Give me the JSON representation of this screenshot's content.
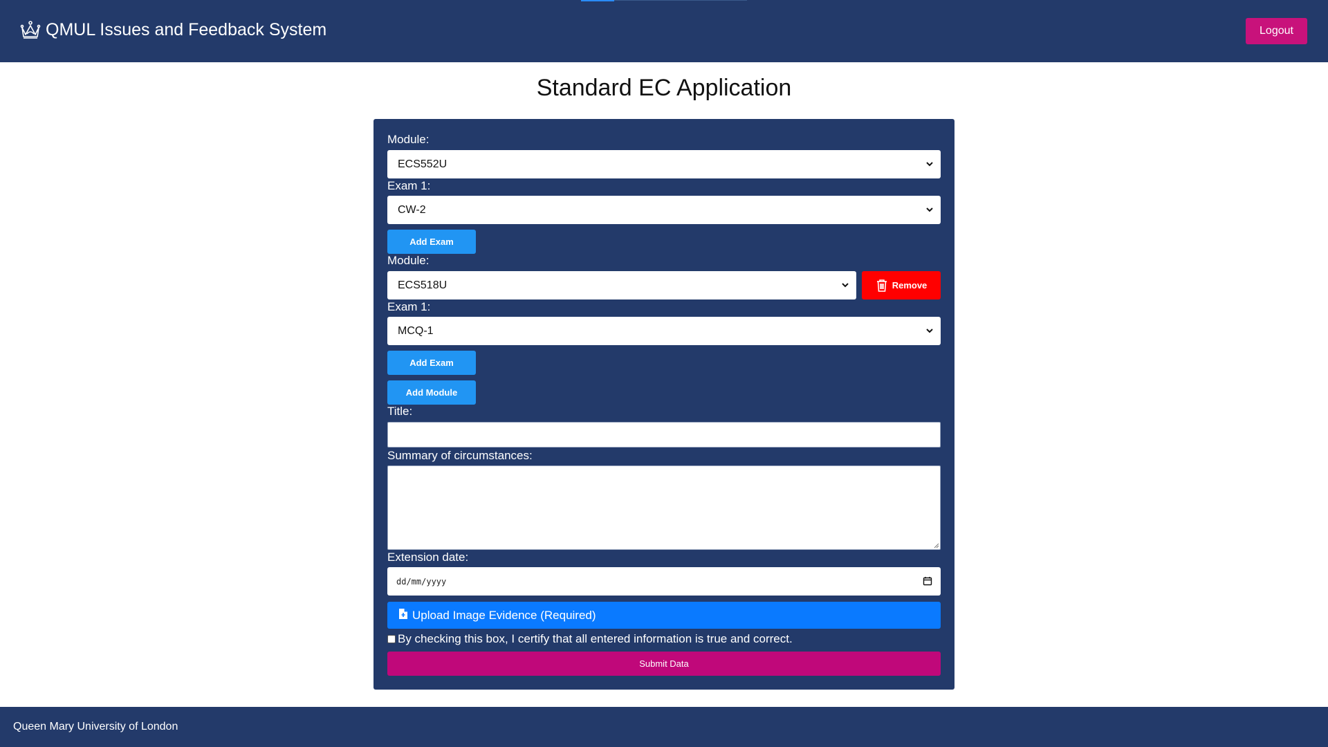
{
  "header": {
    "title": "QMUL Issues and Feedback System",
    "logout_label": "Logout",
    "logo_icon": "crown-icon",
    "colors": {
      "bar": "#233a6a",
      "logout": "#c8127b"
    }
  },
  "page_title": "Standard EC Application",
  "form": {
    "modules": [
      {
        "module_label": "Module:",
        "module_value": "ECS552U",
        "exam_label": "Exam 1:",
        "exam_value": "CW-2",
        "add_exam_label": "Add Exam"
      },
      {
        "module_label": "Module:",
        "module_value": "ECS518U",
        "remove_label": "Remove",
        "exam_label": "Exam 1:",
        "exam_value": "MCQ-1",
        "add_exam_label": "Add Exam"
      }
    ],
    "add_module_label": "Add Module",
    "title_label": "Title:",
    "title_value": "",
    "summary_label": "Summary of circumstances:",
    "summary_value": "",
    "extension_label": "Extension date:",
    "extension_placeholder": "dd/mm/yyyy",
    "upload_label": "Upload Image Evidence (Required)",
    "certify_label": "By checking this box, I certify that all entered information is true and correct.",
    "certify_checked": false,
    "submit_label": "Submit Data",
    "colors": {
      "card": "#233a6a",
      "blue_button": "#2195f3",
      "remove_button": "#ff0000",
      "upload_button": "#0a7aff",
      "submit_button": "#c0087a"
    }
  },
  "footer": {
    "text": "Queen Mary University of London"
  }
}
